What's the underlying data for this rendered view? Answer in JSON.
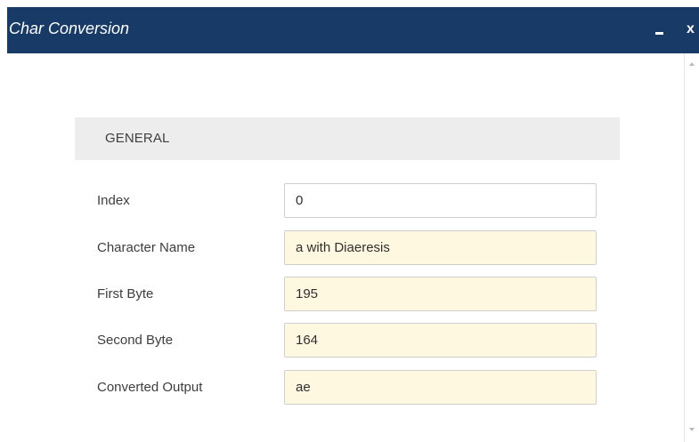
{
  "window": {
    "title": "Char Conversion",
    "minimize_label": "",
    "close_label": "x"
  },
  "section": {
    "title": "GENERAL"
  },
  "fields": [
    {
      "label": "Index",
      "value": "0"
    },
    {
      "label": "Character Name",
      "value": "a with Diaeresis"
    },
    {
      "label": "First Byte",
      "value": "195"
    },
    {
      "label": "Second Byte",
      "value": "164"
    },
    {
      "label": "Converted Output",
      "value": "ae"
    }
  ],
  "colors": {
    "titlebar": "#173a66",
    "section_bg": "#ededed",
    "readonly_bg": "#fff8e1",
    "border": "#cfcfcf"
  }
}
